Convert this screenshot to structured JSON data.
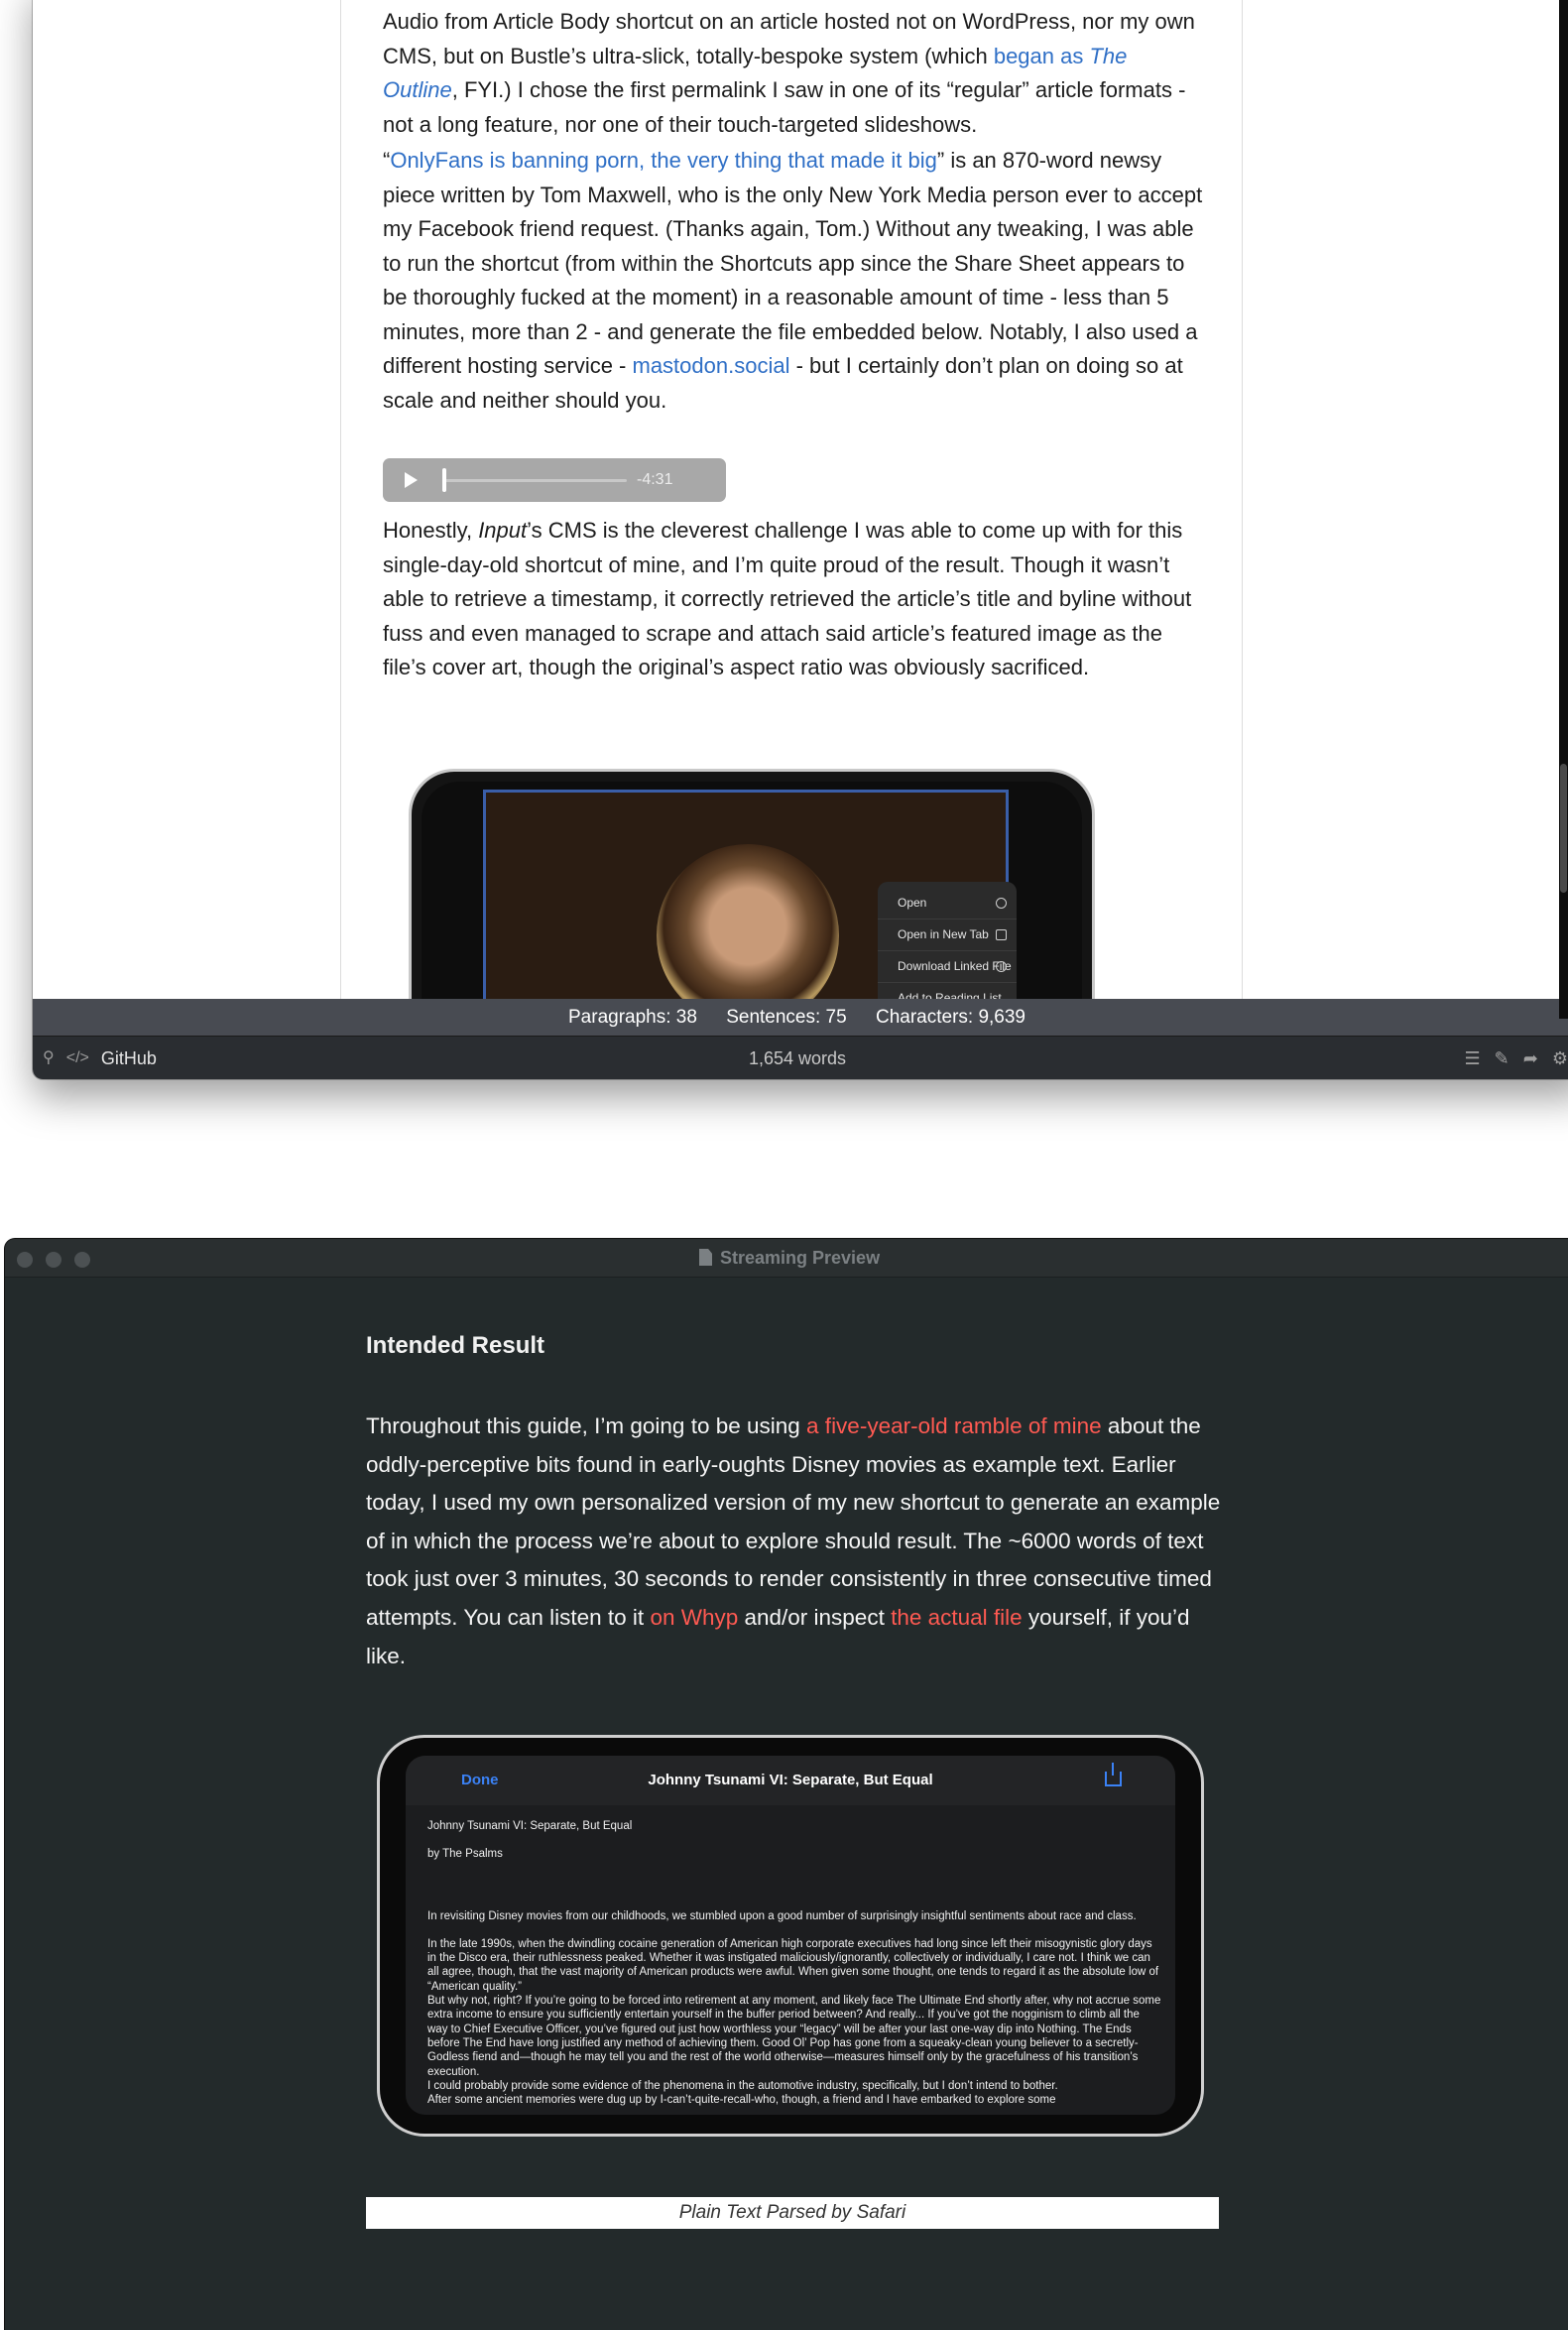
{
  "editor": {
    "paragraph1": {
      "t1": "Audio from Article Body shortcut on an article hosted not on WordPress, nor my own CMS, but on Bustle’s ultra-slick, totally-bespoke system (which ",
      "link": "began as ",
      "link_italic": "The Outline",
      "t2": ", FYI.) I chose the first permalink I saw in one of its “regular” article formats - not a long feature, nor one of their touch-targeted slideshows."
    },
    "paragraph2": {
      "open_quote": "“",
      "link1": "OnlyFans is banning porn, the very thing that made it big",
      "t1": "” is an 870-word newsy piece written by Tom Maxwell, who is the only New York Media person ever to accept my Facebook friend request. (Thanks again, Tom.) Without any tweaking, I was able to run the shortcut (from within the Shortcuts app since the Share Sheet appears to be thoroughly fucked at the moment) in a reasonable amount of time - less than 5 minutes, more than 2 - and generate the file embedded below. Notably, I also used a different hosting service - ",
      "link2": "mastodon.social",
      "t2": " - but I certainly don’t plan on doing so at scale and neither should you."
    },
    "audio": {
      "time_remaining": "-4:31",
      "progress": 0.0
    },
    "paragraph3": {
      "t1": "Honestly, ",
      "italic": "Input",
      "t2": "’s CMS is the cleverest challenge I was able to come up with for this single-day-old shortcut of mine, and I’m quite proud of the result. Though it wasn’t able to retrieve a timestamp, it correctly retrieved the article’s title and byline without fuss and even managed to scrape and attach said article’s featured image as the file’s cover art, though the original’s aspect ratio was obviously sacrificed."
    },
    "phone_menu": [
      "Open",
      "Open in New Tab",
      "Download Linked File",
      "Add to Reading List"
    ],
    "stats": {
      "paragraphs": "Paragraphs: 38",
      "sentences": "Sentences: 75",
      "characters": "Characters: 9,639"
    },
    "toolbar": {
      "github_label": "GitHub",
      "word_count": "1,654 words"
    }
  },
  "preview": {
    "window_title": "Streaming Preview",
    "heading": "Intended Result",
    "paragraph": {
      "t1": "Throughout this guide, I’m going to be using ",
      "link1": "a five-year-old ramble of mine",
      "t2": " about the oddly-perceptive bits found in early-oughts Disney movies as example text. Earlier today, I used my own personalized version of my new shortcut to generate an example of in which the process we’re about to explore should result. The ~6000 words of text took just over 3 minutes, 30 seconds to render consistently in three consecutive timed attempts. You can listen to it ",
      "link2": "on Whyp",
      "t3": " and/or inspect ",
      "link3": "the actual file",
      "t4": " yourself, if you’d like."
    },
    "phone": {
      "done_label": "Done",
      "nav_title": "Johnny Tsunami VI: Separate, But Equal",
      "doc_title": "Johnny Tsunami VI: Separate, But Equal",
      "byline": "by The Psalms",
      "p1": "In revisiting Disney movies from our childhoods, we stumbled upon a good number of surprisingly insightful sentiments about race and class.",
      "p2": "In the late 1990s, when the dwindling cocaine generation of American high corporate executives had long since left their misogynistic glory days in the Disco era, their ruthlessness peaked. Whether it was instigated maliciously/ignorantly, collectively or individually, I care not. I think we can all agree, though, that the vast majority of American products were awful. When given some thought, one tends to regard it as the absolute low of “American quality.”",
      "p3": "But why not, right? If you’re going to be forced into retirement at any moment, and likely face The Ultimate End shortly after, why not accrue some extra income to ensure you sufficiently entertain yourself in the buffer period between? And really... If you’ve got the nogginism to climb all the way to Chief Executive Officer, you’ve figured out just how worthless your “legacy” will be after your last one-way dip into Nothing. The Ends before The End have long justified any method of achieving them. Good Ol’ Pop has gone from a squeaky-clean young believer to a secretly-Godless fiend and—though he may tell you and the rest of the world otherwise—measures himself only by the gracefulness of his transition’s execution.",
      "p4": "I could probably provide some evidence of the phenomena in the automotive industry, specifically, but I don’t intend to bother.",
      "p5": "After some ancient memories were dug up by I-can’t-quite-recall-who, though, a friend and I have embarked to explore some"
    },
    "caption": "Plain Text Parsed by Safari"
  }
}
